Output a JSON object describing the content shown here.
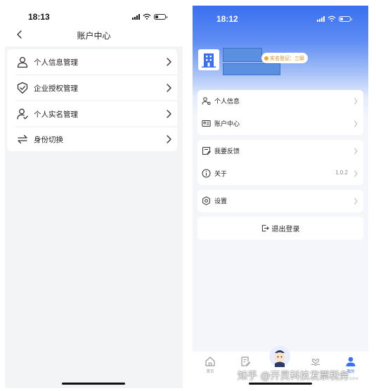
{
  "left": {
    "status_time": "18:13",
    "nav_title": "账户中心",
    "items": [
      {
        "label": "个人信息管理",
        "icon": "person-icon"
      },
      {
        "label": "企业授权管理",
        "icon": "shield-check-icon"
      },
      {
        "label": "个人实名管理",
        "icon": "person-verified-icon"
      },
      {
        "label": "身份切换",
        "icon": "switch-arrows-icon"
      }
    ]
  },
  "right": {
    "status_time": "18:12",
    "realname_badge": "实名登记：三级",
    "groups": [
      [
        {
          "label": "个人信息",
          "icon": "person-card-icon"
        },
        {
          "label": "账户中心",
          "icon": "id-card-icon"
        }
      ],
      [
        {
          "label": "我要反馈",
          "icon": "feedback-icon"
        },
        {
          "label": "关于",
          "icon": "info-icon",
          "value": "1.0.2"
        }
      ],
      [
        {
          "label": "设置",
          "icon": "gear-icon"
        }
      ]
    ],
    "logout_label": "退出登录",
    "tabs": [
      {
        "label": "首页",
        "icon": "home-icon"
      },
      {
        "label": "",
        "icon": "document-edit-icon"
      },
      {
        "label": "",
        "icon": "mascot-icon"
      },
      {
        "label": "",
        "icon": "heart-hand-icon"
      },
      {
        "label": "我的",
        "icon": "user-icon"
      }
    ]
  },
  "watermark": "知乎 @开灵科技发票税务...",
  "colors": {
    "accent": "#3a70f0",
    "name_block": "#5b8fe0",
    "badge_text": "#d98a1c",
    "badge_dot": "#f0a830"
  }
}
